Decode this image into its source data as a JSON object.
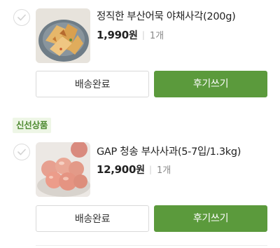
{
  "items": [
    {
      "name": "정직한 부산어묵 야채사각(200g)",
      "price": "1,990",
      "currency": "원",
      "quantity": "1개",
      "delivered_label": "배송완료",
      "review_label": "후기쓰기"
    },
    {
      "badge": "신선상품",
      "name": "GAP 청송 부사사과(5-7입/1.3kg)",
      "price": "12,900",
      "currency": "원",
      "quantity": "1개",
      "delivered_label": "배송완료",
      "review_label": "후기쓰기"
    }
  ],
  "colors": {
    "accent_green": "#5b9a3c",
    "badge_bg": "#eef6e6",
    "badge_text": "#4e8a31"
  },
  "icons": {
    "checkbox": "check-circle-icon"
  }
}
